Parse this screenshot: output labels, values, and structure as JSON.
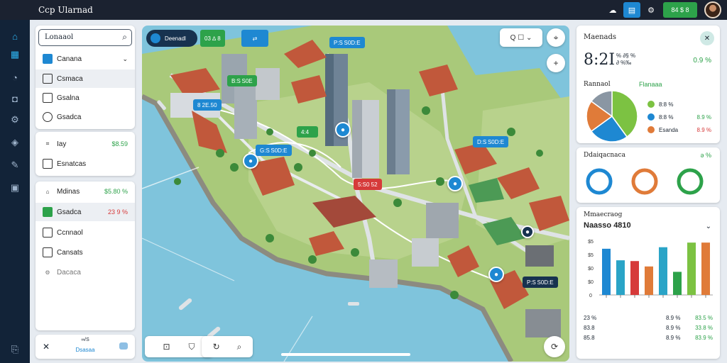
{
  "app": {
    "title": "Ccp Ularnad"
  },
  "topbar": {
    "green_button_label": "84 $ 8"
  },
  "rail": {
    "icons": [
      "logo-icon",
      "home-icon",
      "grid-icon",
      "chat-icon",
      "camera-icon",
      "settings-icon",
      "compass-icon",
      "monitor-icon",
      "exit-icon"
    ]
  },
  "left_panel": {
    "search": {
      "value": "Lonaaol"
    },
    "group1": [
      {
        "label": "Canana",
        "icon": "dropdown"
      },
      {
        "label": "Csmaca"
      },
      {
        "label": "Gsalna"
      },
      {
        "label": "Gsadca"
      }
    ],
    "group2": [
      {
        "label": "Iay",
        "value": "$8.59"
      },
      {
        "label": "Esnatcas"
      }
    ],
    "group3": [
      {
        "label": "Mdinas",
        "value": "$5.80 %"
      },
      {
        "label": "Gsadca",
        "value": "23 9 %"
      },
      {
        "label": "Ccnnaol"
      },
      {
        "label": "Cansats"
      },
      {
        "label": "Dacaca"
      }
    ],
    "footer": {
      "label": "Dsasaa",
      "sublabel": "∞/S"
    }
  },
  "map": {
    "header_tag": "Deenadl",
    "header_stat": "03 ∆ 8",
    "tags": [
      {
        "text": "P:S S0D:E",
        "color": "blue"
      },
      {
        "text": "8 2E.50",
        "color": "blue"
      },
      {
        "text": "D:S S0D:E",
        "color": "blue"
      },
      {
        "text": "B:S S0E",
        "color": "green"
      },
      {
        "text": "4:4    ",
        "color": "green"
      },
      {
        "text": "G:S S0D:E",
        "color": "blue"
      },
      {
        "text": "5:S0 52",
        "color": "red"
      },
      {
        "text": "P:S S0D:E",
        "color": "navy"
      }
    ],
    "search_placeholder": "Q  ☐ ⌄"
  },
  "right_panel": {
    "card1": {
      "title": "Maenads",
      "big_value": "8:2I",
      "sub_value": "% ∂§ %\n∂ %‰",
      "stat": "0.9 %",
      "pie_title": "Rannaol",
      "legend_title": "Flanaaa",
      "legend": [
        {
          "label": "8:8 %",
          "value": "",
          "color": "#7cc242"
        },
        {
          "label": "8:8 %",
          "value": "8.9 %",
          "color": "#1e88d2"
        },
        {
          "label": "Esanda",
          "value": "8.9 %",
          "color": "#e07b39"
        }
      ],
      "pie": [
        {
          "label": "green",
          "value": 40,
          "color": "#7cc242"
        },
        {
          "label": "blue",
          "value": 25,
          "color": "#1e88d2"
        },
        {
          "label": "orange",
          "value": 20,
          "color": "#e07b39"
        },
        {
          "label": "gray",
          "value": 15,
          "color": "#8a96a3"
        }
      ]
    },
    "card2": {
      "title": "Ddaiqacnaca",
      "stat": "ǝ %",
      "rings": [
        {
          "color": "#1e88d2"
        },
        {
          "color": "#e07b39"
        },
        {
          "color": "#2da24a"
        }
      ]
    },
    "card3": {
      "title": "Mmaecraog",
      "subtitle": "Naasso 4810",
      "ytick_labels": [
        "$5",
        "$5",
        "$0",
        "$0",
        "0"
      ],
      "table": [
        {
          "a": "23 %",
          "b": "8.9 %",
          "c": "83.5 %"
        },
        {
          "a": "83.8",
          "b": "8.9 %",
          "c": "33.8 %"
        },
        {
          "a": "85.8",
          "b": "8.9 %",
          "c": "83.9 %"
        }
      ]
    }
  },
  "chart_data": {
    "type": "bar",
    "categories": [
      "a",
      "b",
      "c",
      "d",
      "e",
      "f",
      "g",
      "h"
    ],
    "values": [
      60,
      45,
      44,
      37,
      62,
      30,
      68,
      68
    ],
    "colors": [
      "#1e88d2",
      "#2aa4c7",
      "#d63a3a",
      "#e07b39",
      "#2aa4c7",
      "#2da24a",
      "#7cc242",
      "#e07b39"
    ],
    "ylim": [
      0,
      70
    ]
  }
}
